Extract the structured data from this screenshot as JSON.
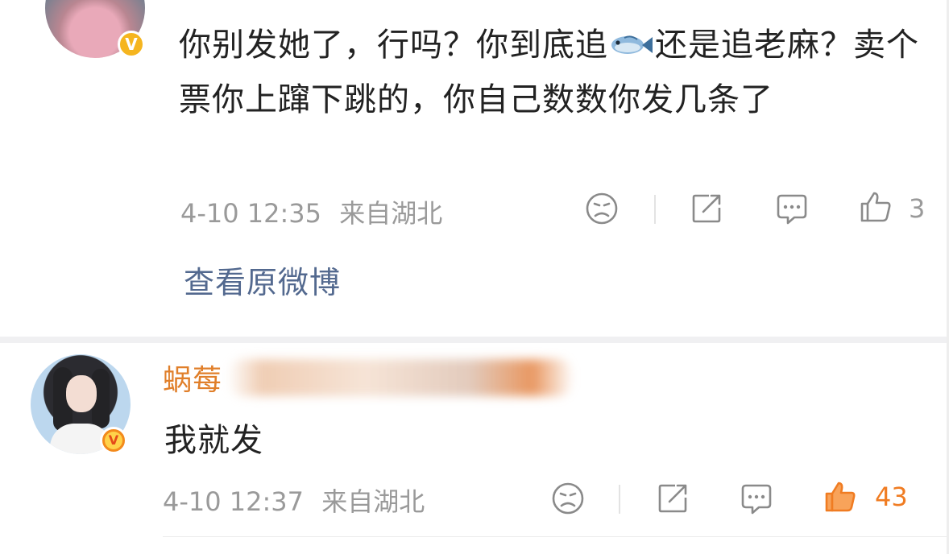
{
  "comment1": {
    "text_part1": "你别发她了，行吗？你到底追",
    "text_emoji": "fish-emoji",
    "text_part2": "还是追老麻？卖个票你上蹿下跳的，你自己数数你发几条了",
    "time": "4-10 12:35",
    "location": "来自湖北",
    "like_count": "3",
    "view_original_label": "查看原微博"
  },
  "comment2": {
    "username_visible": "蜗莓",
    "text": "我就发",
    "time": "4-10 12:37",
    "location": "来自湖北",
    "like_count": "43",
    "liked": true
  },
  "colors": {
    "link": "#53698f",
    "username": "#e07f2a",
    "liked": "#f07c22",
    "meta": "#9a9a9a",
    "verified_gold": "#f5b51f",
    "verified_red": "#f38a1c"
  },
  "icons": [
    "sad-face-icon",
    "share-icon",
    "comment-icon",
    "thumbs-up-icon"
  ]
}
